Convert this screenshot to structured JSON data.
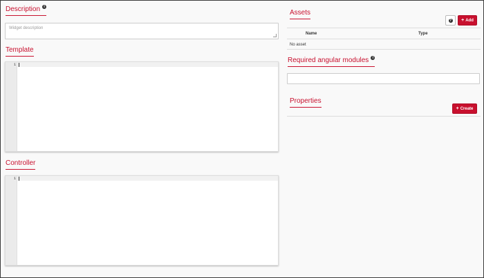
{
  "description": {
    "title": "Description",
    "placeholder": "Widget description",
    "value": ""
  },
  "template": {
    "title": "Template",
    "line_number": "1"
  },
  "controller": {
    "title": "Controller",
    "line_number": "1"
  },
  "assets": {
    "title": "Assets",
    "help_label": "?",
    "add_label": "Add",
    "columns": [
      "Name",
      "Type"
    ],
    "empty_text": "No asset"
  },
  "modules": {
    "title": "Required angular modules",
    "value": ""
  },
  "properties": {
    "title": "Properties",
    "create_label": "Create"
  },
  "colors": {
    "accent": "#c8102e",
    "background": "#f9f9f9"
  }
}
